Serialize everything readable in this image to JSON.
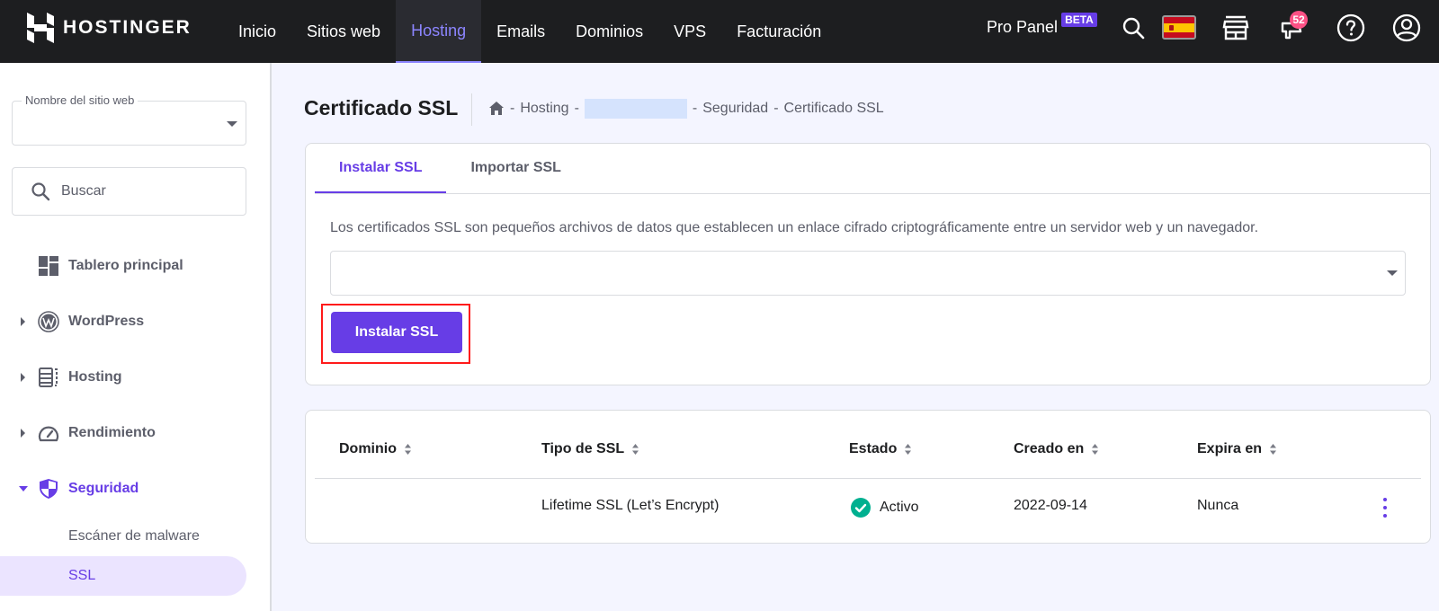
{
  "topbar": {
    "brand": "HOSTINGER",
    "nav": [
      {
        "label": "Inicio",
        "active": false
      },
      {
        "label": "Sitios web",
        "active": false
      },
      {
        "label": "Hosting",
        "active": true
      },
      {
        "label": "Emails",
        "active": false
      },
      {
        "label": "Dominios",
        "active": false
      },
      {
        "label": "VPS",
        "active": false
      },
      {
        "label": "Facturación",
        "active": false
      }
    ],
    "pro_panel_label": "Pro Panel",
    "pro_panel_badge": "BETA",
    "icons": [
      "search-icon",
      "spain-flag-icon",
      "store-icon",
      "megaphone-icon",
      "help-icon",
      "account-icon"
    ],
    "notifications_count": "52",
    "accent_color": "#8c85ff"
  },
  "sidebar": {
    "site_select_label": "Nombre del sitio web",
    "site_select_value": "",
    "search_placeholder": "Buscar",
    "items": [
      {
        "label": "Tablero principal",
        "icon": "dashboard-icon",
        "expandable": false
      },
      {
        "label": "WordPress",
        "icon": "wordpress-icon",
        "expandable": true
      },
      {
        "label": "Hosting",
        "icon": "server-icon",
        "expandable": true
      },
      {
        "label": "Rendimiento",
        "icon": "speedometer-icon",
        "expandable": true
      },
      {
        "label": "Seguridad",
        "icon": "shield-icon",
        "expandable": true,
        "expanded": true,
        "active": true
      }
    ],
    "subitems": [
      {
        "label": "Escáner de malware",
        "active": false
      },
      {
        "label": "SSL",
        "active": true
      }
    ]
  },
  "header": {
    "title": "Certificado SSL",
    "breadcrumb": [
      "Hosting",
      "",
      "Seguridad",
      "Certificado SSL"
    ],
    "separator": "-"
  },
  "install_card": {
    "tabs": [
      {
        "label": "Instalar SSL",
        "active": true
      },
      {
        "label": "Importar SSL",
        "active": false
      }
    ],
    "description": "Los certificados SSL son pequeños archivos de datos que establecen un enlace cifrado criptográficamente entre un servidor web y un navegador.",
    "select_value": "",
    "install_button": "Instalar SSL",
    "primary_color": "#673de6"
  },
  "ssl_table": {
    "columns": [
      "Dominio",
      "Tipo de SSL",
      "Estado",
      "Creado en",
      "Expira en"
    ],
    "rows": [
      {
        "domain": "",
        "type": "Lifetime SSL (Let’s Encrypt)",
        "status": "Activo",
        "created": "2022-09-14",
        "expires": "Nunca"
      }
    ],
    "status_color": "#00b090"
  }
}
